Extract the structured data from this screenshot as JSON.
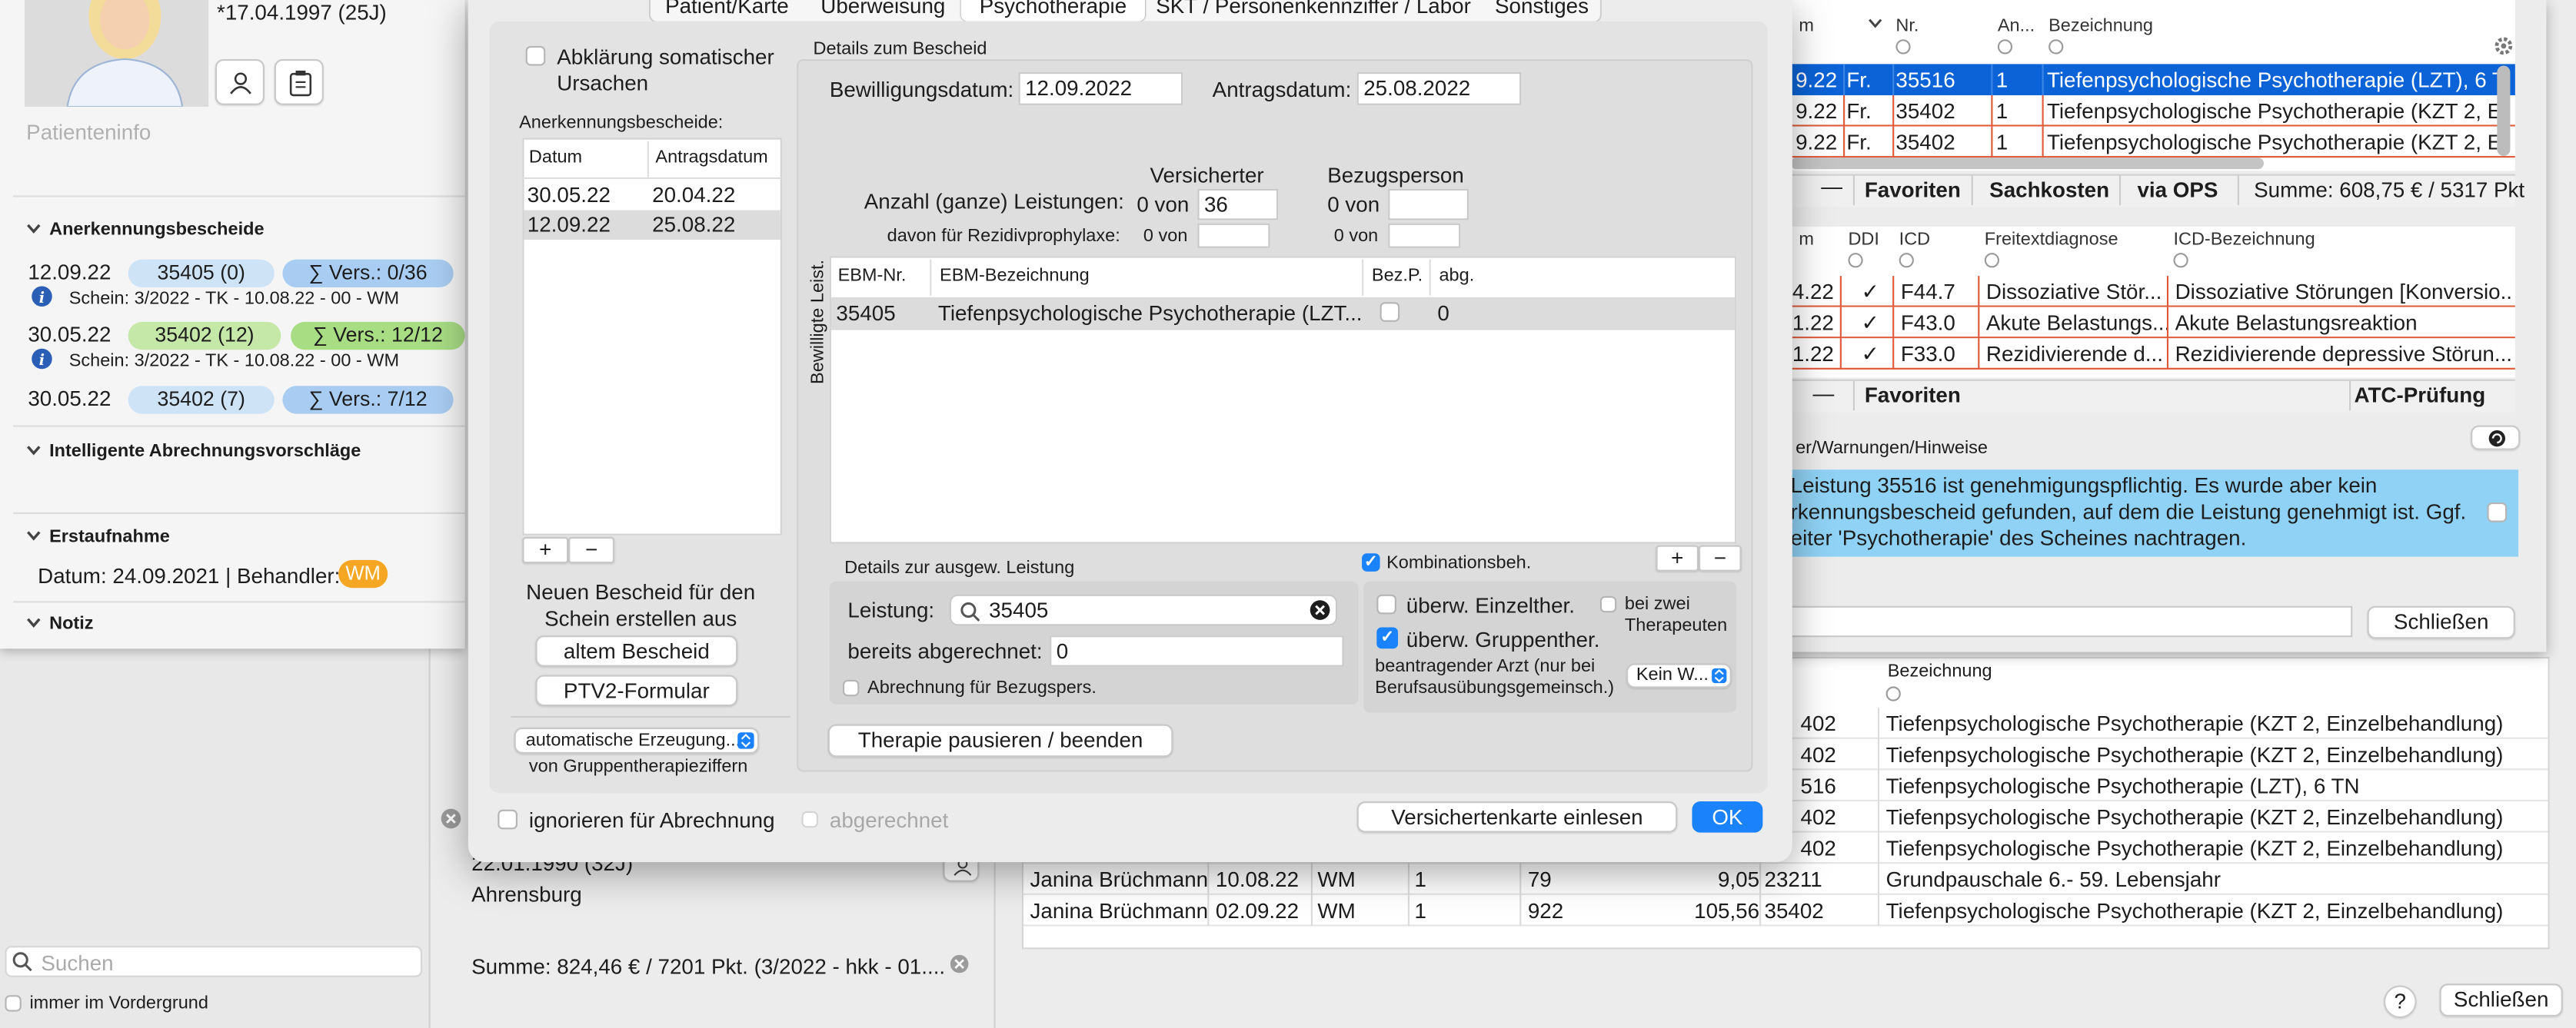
{
  "patient": {
    "birth": "*17.04.1997 (25J)",
    "info_placeholder": "Patienteninfo"
  },
  "sections": {
    "anerkennung": {
      "title": "Anerkennungsbescheide",
      "items": [
        {
          "date": "12.09.22",
          "code": "35405 (0)",
          "vers": "∑ Vers.: 0/36",
          "schein": "Schein: 3/2022 - TK - 10.08.22 - 00 - WM"
        },
        {
          "date": "30.05.22",
          "code": "35402 (12)",
          "vers": "∑ Vers.: 12/12",
          "schein": "Schein: 3/2022 - TK - 10.08.22 - 00 - WM"
        },
        {
          "date": "30.05.22",
          "code": "35402 (7)",
          "vers": "∑ Vers.: 7/12"
        }
      ]
    },
    "vorschlaege": "Intelligente Abrechnungsvorschläge",
    "erstaufnahme": {
      "title": "Erstaufnahme",
      "text": "Datum: 24.09.2021 | Behandler:",
      "badge": "WM"
    },
    "notiz": "Notiz"
  },
  "left_bottom": {
    "search_placeholder": "Suchen",
    "vordergrund": "immer im Vordergrund",
    "patient_dob": "22.01.1990 (32J)",
    "patient_city": "Ahrensburg",
    "summe": "Summe: 824,46 € / 7201 Pkt. (3/2022 - hkk - 01...."
  },
  "tabs": [
    "Patient/Karte",
    "Überweisung",
    "Psychotherapie",
    "SKT / Personenkennziffer / Labor",
    "Sonstiges"
  ],
  "active_tab": "Psychotherapie",
  "psy": {
    "somatisch": "Abklärung somatischer Ursachen",
    "bescheide_label": "Anerkennungsbescheide:",
    "bescheide_headers": [
      "Datum",
      "Antragsdatum"
    ],
    "bescheide_rows": [
      [
        "30.05.22",
        "20.04.22"
      ],
      [
        "12.09.22",
        "25.08.22"
      ]
    ],
    "neu_label": "Neuen Bescheid für den Schein erstellen aus",
    "alt_button": "altem Bescheid",
    "ptv2_button": "PTV2-Formular",
    "auto_select": "automatische Erzeugung...",
    "gruppe_label": "von Gruppentherapieziffern",
    "details_title": "Details zum Bescheid",
    "bewilligung_label": "Bewilligungsdatum:",
    "bewilligung": "12.09.2022",
    "antrag_label": "Antragsdatum:",
    "antrag": "25.08.2022",
    "versicherter": "Versicherter",
    "bezugsperson": "Bezugsperson",
    "anzahl_label": "Anzahl (ganze) Leistungen:",
    "von0": "0 von",
    "anzahl_value": "36",
    "rezidiv_label": "davon für Rezidivprophylaxe:",
    "vertical_label": "Bewilligte Leist.",
    "leist_headers": [
      "EBM-Nr.",
      "EBM-Bezeichnung",
      "Bez.P.",
      "abg."
    ],
    "leist_rows": [
      [
        "35405",
        "Tiefenpsychologische Psychotherapie (LZT...",
        "",
        "0"
      ]
    ],
    "ausgew_title": "Details zur ausgew. Leistung",
    "leistung_label": "Leistung:",
    "leistung_value": "35405",
    "abgerechnet_label": "bereits abgerechnet:",
    "abgerechnet_value": "0",
    "bezugspers_label": "Abrechnung für Bezugspers.",
    "kombi": "Kombinationsbeh.",
    "einzel": "überw. Einzelther.",
    "gruppe": "überw. Gruppenther.",
    "zwei": "bei zwei Therapeuten",
    "beantragend": "beantragender Arzt (nur bei Berufsausübungsgemeinsch.)",
    "kein": "Kein W...",
    "pause_button": "Therapie pausieren / beenden",
    "ignorieren": "ignorieren für Abrechnung",
    "abgerechnet_cb": "abgerechnet",
    "karte_button": "Versichertenkarte einlesen",
    "ok_button": "OK"
  },
  "right": {
    "lhdr": [
      "m",
      "Nr.",
      "An...",
      "Bezeichnung"
    ],
    "lrows": [
      {
        "d": "9.22",
        "f": "Fr.",
        "nr": "35516",
        "an": "1",
        "bez": "Tiefenpsychologische Psychotherapie (LZT), 6 T"
      },
      {
        "d": "9.22",
        "f": "Fr.",
        "nr": "35402",
        "an": "1",
        "bez": "Tiefenpsychologische Psychotherapie (KZT 2, Ei"
      },
      {
        "d": "9.22",
        "f": "Fr.",
        "nr": "35402",
        "an": "1",
        "bez": "Tiefenpsychologische Psychotherapie (KZT 2, Ei"
      }
    ],
    "tb1": {
      "fav": "Favoriten",
      "sach": "Sachkosten",
      "ops": "via OPS",
      "summe": "Summe: 608,75 € / 5317 Pkt"
    },
    "dhdr": [
      "m",
      "DDI",
      "ICD",
      "Freitextdiagnose",
      "ICD-Bezeichnung"
    ],
    "drows": [
      {
        "d": "4.22",
        "icd": "F44.7",
        "frei": "Dissoziative Stör...",
        "bez": "Dissoziative Störungen [Konversio..."
      },
      {
        "d": "1.22",
        "icd": "F43.0",
        "frei": "Akute Belastungs...",
        "bez": "Akute Belastungsreaktion"
      },
      {
        "d": "1.22",
        "icd": "F33.0",
        "frei": "Rezidivierende d...",
        "bez": "Rezidivierende depressive Störun..."
      }
    ],
    "tb2": {
      "fav": "Favoriten",
      "atc": "ATC-Prüfung"
    },
    "warn_title": "er/Warnungen/Hinweise",
    "warn_text": "Leistung 35516 ist genehmigungspflichtig. Es wurde aber kein rkennungsbescheid gefunden, auf dem die Leistung genehmigt ist. Ggf. eiter 'Psychotherapie' des Scheines nachtragen.",
    "close": "Schließen"
  },
  "back": {
    "hdr": "Bezeichnung",
    "rows": [
      {
        "nr": "402",
        "bez": "Tiefenpsychologische Psychotherapie (KZT 2, Einzelbehandlung)"
      },
      {
        "nr": "402",
        "bez": "Tiefenpsychologische Psychotherapie (KZT 2, Einzelbehandlung)"
      },
      {
        "nr": "516",
        "bez": "Tiefenpsychologische Psychotherapie (LZT), 6 TN"
      },
      {
        "nr": "402",
        "bez": "Tiefenpsychologische Psychotherapie (KZT 2, Einzelbehandlung)"
      },
      {
        "nr": "402",
        "bez": "Tiefenpsychologische Psychotherapie (KZT 2, Einzelbehandlung)"
      },
      {
        "name": "Janina Brüchmann",
        "date": "10.08.22",
        "arzt": "WM",
        "anz": "1",
        "pkt": "79",
        "eur": "9,05",
        "nr": "23211",
        "bez": "Grundpauschale 6.- 59. Lebensjahr"
      },
      {
        "name": "Janina Brüchmann",
        "date": "02.09.22",
        "arzt": "WM",
        "anz": "1",
        "pkt": "922",
        "eur": "105,56",
        "nr": "35402",
        "bez": "Tiefenpsychologische Psychotherapie (KZT 2, Einzelbehandlung)"
      }
    ],
    "help": "?",
    "close": "Schließen"
  },
  "colors": {
    "accent": "#1a82fb",
    "select": "#0b63d7",
    "green": "#a8dd84",
    "blue": "#bfdcf7",
    "orange": "#f5a623",
    "warn": "#8fd2f5"
  }
}
